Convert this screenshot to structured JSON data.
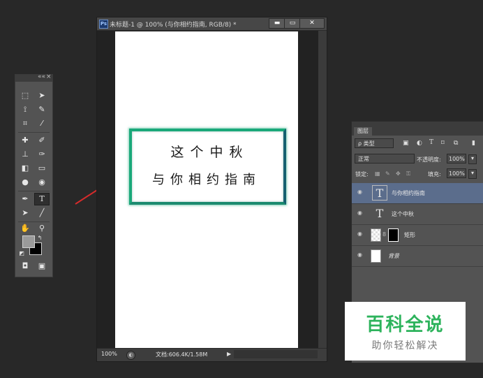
{
  "document": {
    "app_badge": "Ps",
    "title": "未标题-1 @ 100% (与你相约指南, RGB/8) *",
    "buttons": {
      "minimize": "▬",
      "restore": "▭",
      "close": "✕"
    },
    "canvas": {
      "line1": "这个中秋",
      "line2": "与你相约指南",
      "frame_color": "#1aa879"
    },
    "status": {
      "zoom": "100%",
      "doc_info": "文档:606.4K/1.58M",
      "arrow": "▶"
    }
  },
  "tools": {
    "header_collapse": "««",
    "header_close": "×",
    "foreground_color": "#9a9a9a",
    "background_color": "#000000"
  },
  "layers_panel": {
    "tab_label": "图层",
    "filter_type": "ρ 类型",
    "blend_mode": "正常",
    "opacity_label": "不透明度:",
    "opacity_value": "100%",
    "lock_label": "锁定:",
    "fill_label": "填充:",
    "fill_value": "100%",
    "layers": [
      {
        "name": "与你相约指南",
        "kind": "text",
        "selected": true
      },
      {
        "name": "这个中秋",
        "kind": "text",
        "selected": false
      },
      {
        "name": "矩形",
        "kind": "shape",
        "selected": false
      },
      {
        "name": "背景",
        "kind": "background",
        "selected": false
      }
    ]
  },
  "watermark": {
    "title": "百科全说",
    "subtitle": "助你轻松解决",
    "color": "#2db35c"
  },
  "annotation_arrow_color": "#d62b2b"
}
